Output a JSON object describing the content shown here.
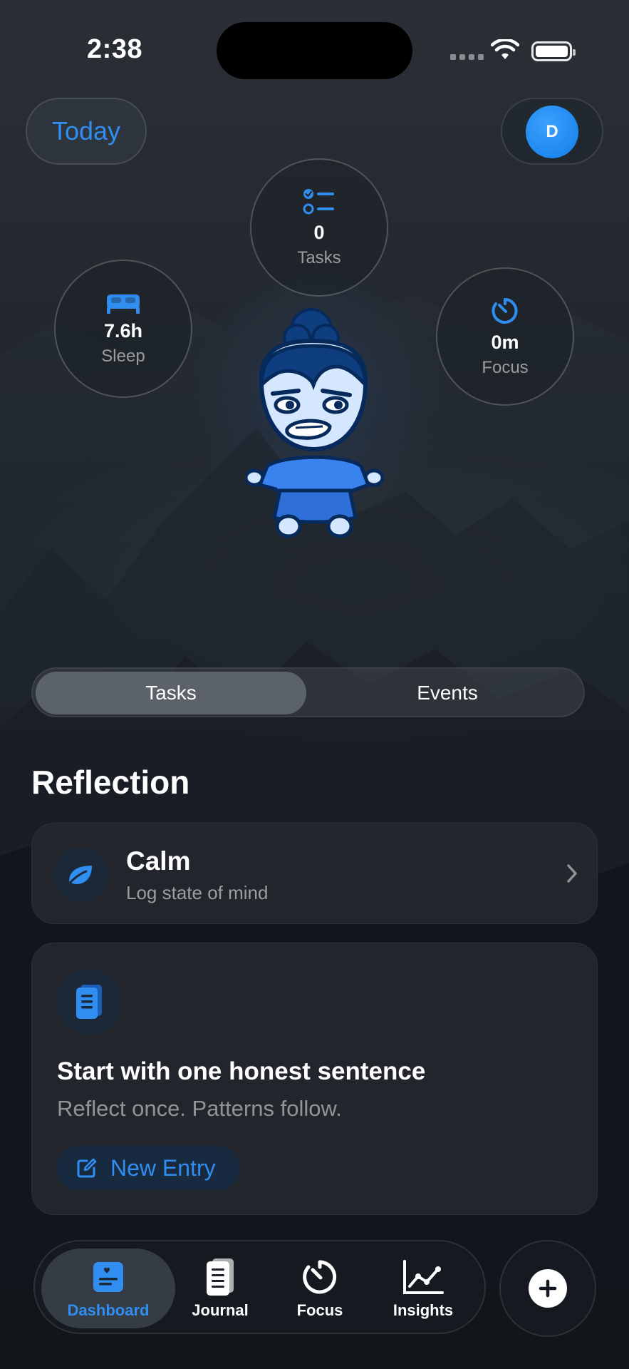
{
  "status": {
    "time": "2:38"
  },
  "header": {
    "today_label": "Today",
    "avatar_initial": "D"
  },
  "stats": {
    "tasks": {
      "value": "0",
      "label": "Tasks"
    },
    "sleep": {
      "value": "7.6h",
      "label": "Sleep"
    },
    "focus": {
      "value": "0m",
      "label": "Focus"
    }
  },
  "segment": {
    "tasks_label": "Tasks",
    "events_label": "Events",
    "selected": "Tasks"
  },
  "reflection": {
    "title": "Reflection",
    "mood": {
      "title": "Calm",
      "subtitle": "Log state of mind"
    },
    "journal": {
      "title": "Start with one honest sentence",
      "subtitle": "Reflect once. Patterns follow.",
      "button_label": "New Entry"
    }
  },
  "tabbar": {
    "items": [
      {
        "label": "Dashboard",
        "icon": "dashboard-icon",
        "active": true
      },
      {
        "label": "Journal",
        "icon": "journal-icon",
        "active": false
      },
      {
        "label": "Focus",
        "icon": "timer-icon",
        "active": false
      },
      {
        "label": "Insights",
        "icon": "chart-icon",
        "active": false
      }
    ],
    "add_icon": "plus-icon"
  },
  "colors": {
    "accent": "#2f8ef0",
    "card": "#24282e",
    "background": "#10161f"
  }
}
